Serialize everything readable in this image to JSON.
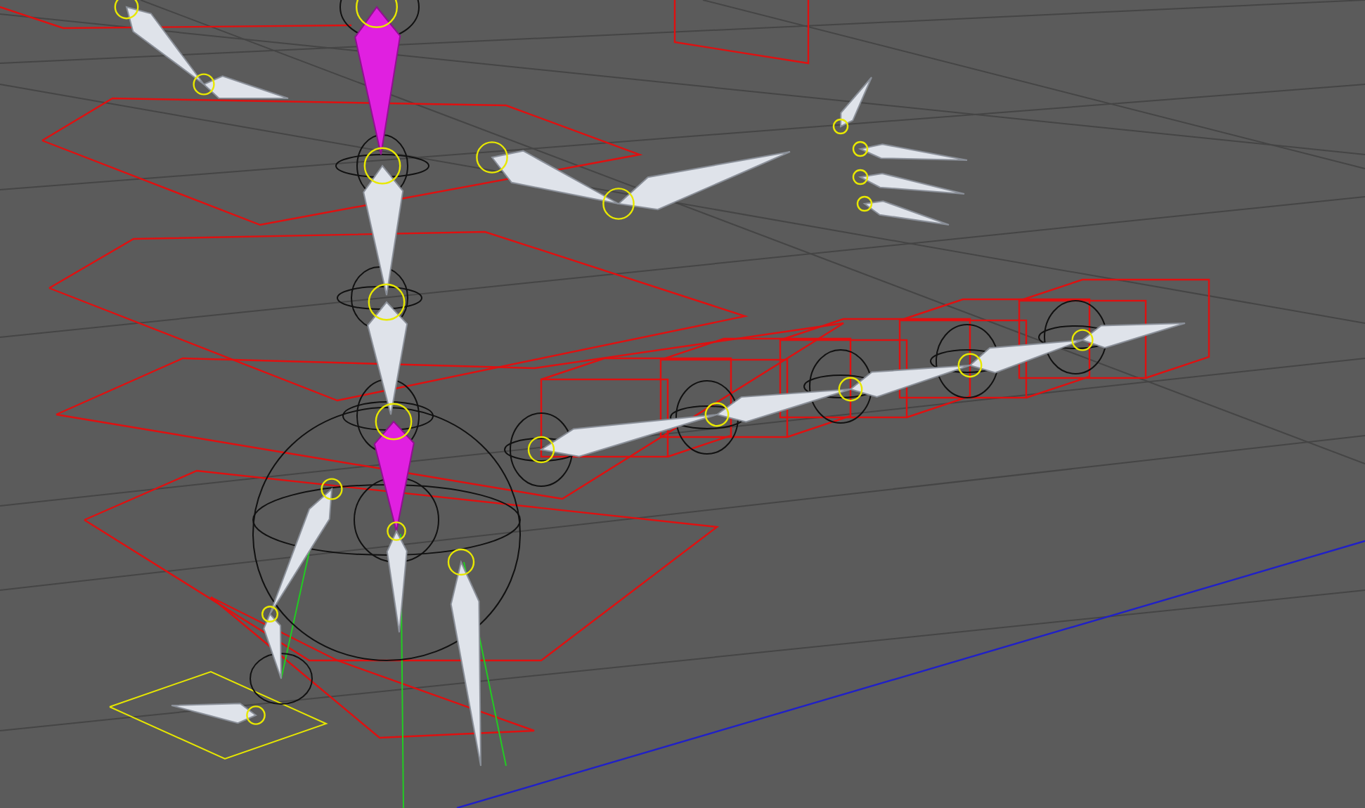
{
  "viewport": {
    "bones": [
      {
        "selected": true
      },
      {
        "selected": false
      },
      {
        "selected": false
      },
      {
        "selected": true
      },
      {
        "selected": false
      },
      {
        "selected": false
      },
      {
        "selected": false
      },
      {
        "selected": false
      },
      {
        "selected": false
      },
      {
        "selected": false
      },
      {
        "selected": false
      },
      {
        "selected": false
      },
      {
        "selected": false
      },
      {
        "selected": false
      },
      {
        "selected": false
      },
      {
        "selected": false
      },
      {
        "selected": false
      },
      {
        "selected": false
      },
      {
        "selected": false
      },
      {
        "selected": false
      },
      {
        "selected": false
      },
      {
        "selected": false
      }
    ]
  }
}
